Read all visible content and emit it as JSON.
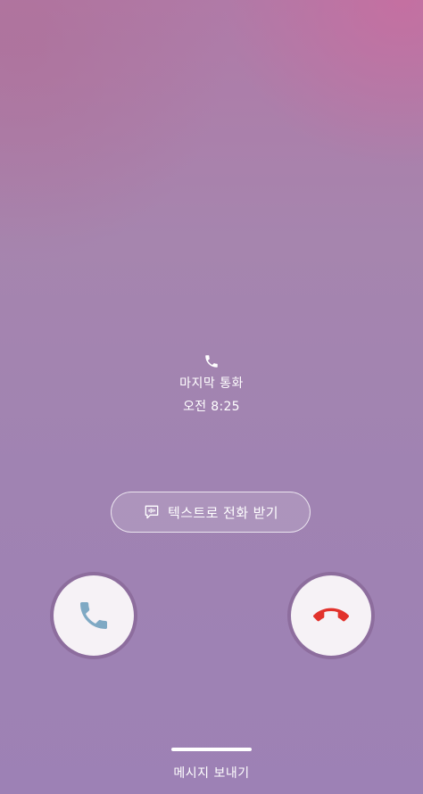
{
  "last_call": {
    "icon": "phone-icon",
    "label": "마지막 통화",
    "time": "오전 8:25"
  },
  "text_call_button": {
    "icon": "chat-waveform-icon",
    "label": "텍스트로 전화 받기"
  },
  "accept_button": {
    "icon": "phone-icon",
    "color": "#7fa9c4"
  },
  "decline_button": {
    "icon": "hang-up-icon",
    "color": "#e2322c"
  },
  "bottom": {
    "send_message_label": "메시지 보내기"
  }
}
